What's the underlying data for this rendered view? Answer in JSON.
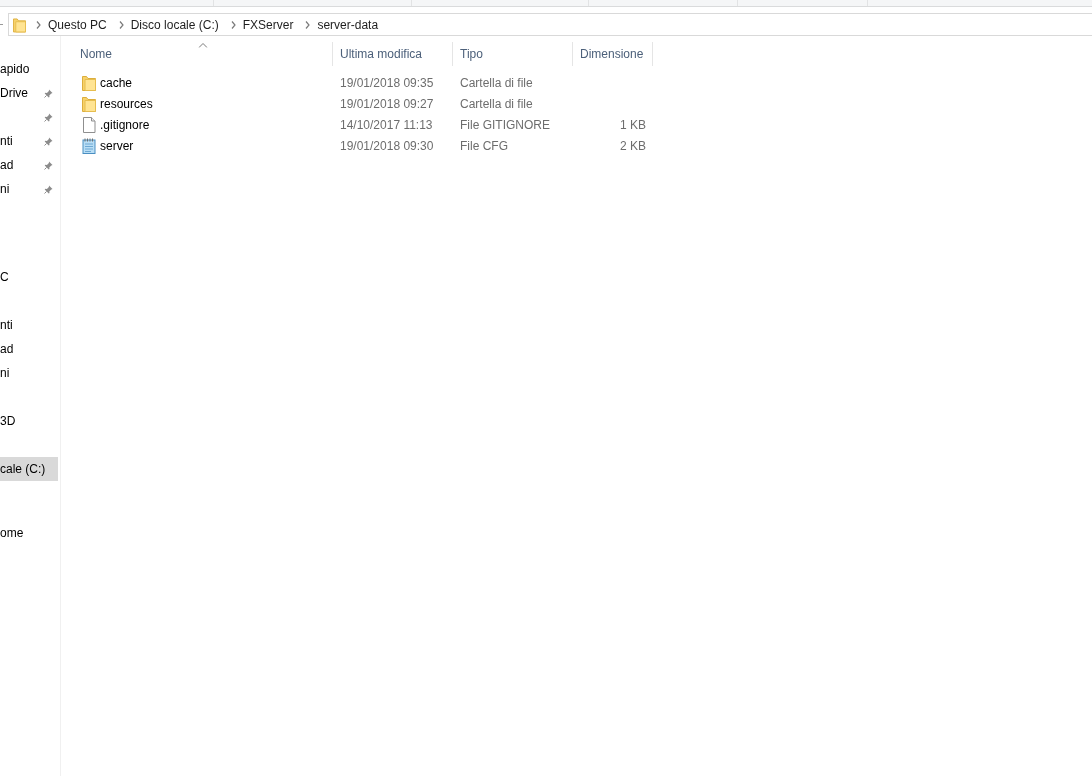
{
  "address_bar": {
    "segments": [
      "Questo PC",
      "Disco locale (C:)",
      "FXServer",
      "server-data"
    ]
  },
  "navigation_pane": {
    "items": [
      {
        "label": "apido",
        "pinned": false,
        "selected": false
      },
      {
        "label": "Drive",
        "pinned": true,
        "selected": false
      },
      {
        "pinned": true,
        "selected": false
      },
      {
        "label": "nti",
        "pinned": true,
        "selected": false
      },
      {
        "label": "ad",
        "pinned": true,
        "selected": false
      },
      {
        "label": "ni",
        "pinned": true,
        "selected": false
      },
      {
        "label": "C",
        "pinned": false,
        "selected": false
      },
      {
        "label": "nti",
        "pinned": false,
        "selected": false
      },
      {
        "label": "ad",
        "pinned": false,
        "selected": false
      },
      {
        "label": "ni",
        "pinned": false,
        "selected": false
      },
      {
        "label": "3D",
        "pinned": false,
        "selected": false
      },
      {
        "label": "cale (C:)",
        "pinned": false,
        "selected": true
      },
      {
        "label": "ome",
        "pinned": false,
        "selected": false
      }
    ]
  },
  "file_list": {
    "columns": [
      {
        "label": "Nome",
        "sorted": true
      },
      {
        "label": "Ultima modifica",
        "sorted": false
      },
      {
        "label": "Tipo",
        "sorted": false
      },
      {
        "label": "Dimensione",
        "sorted": false
      }
    ],
    "rows": [
      {
        "kind": "folder",
        "name": "cache",
        "modified": "19/01/2018 09:35",
        "type": "Cartella di file"
      },
      {
        "kind": "folder",
        "name": "resources",
        "modified": "19/01/2018 09:27",
        "type": "Cartella di file"
      },
      {
        "kind": "file",
        "name": ".gitignore",
        "modified": "14/10/2017 11:13",
        "type": "File GITIGNORE",
        "size": "1 KB"
      },
      {
        "kind": "config",
        "name": "server",
        "modified": "19/01/2018 09:30",
        "type": "File CFG",
        "size": "2 KB"
      }
    ]
  }
}
